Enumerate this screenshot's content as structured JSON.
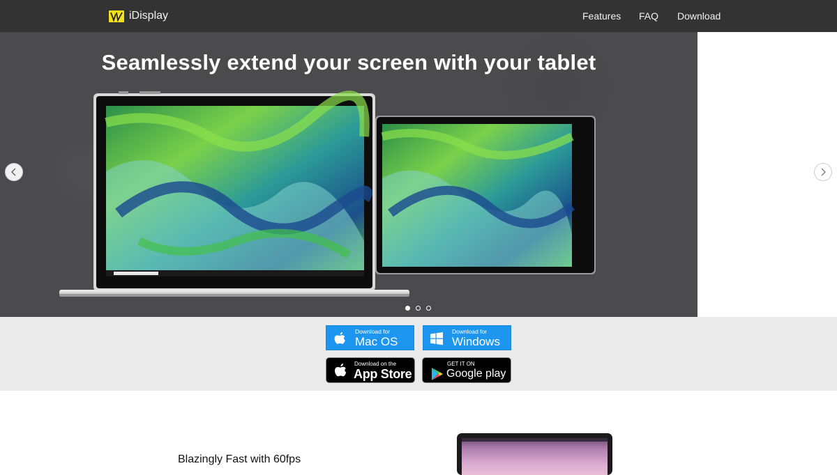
{
  "navbar": {
    "brand": "iDisplay",
    "links": [
      "Features",
      "FAQ",
      "Download"
    ]
  },
  "hero": {
    "title": "Seamlessly extend your screen with your tablet",
    "slide_count": 3,
    "active_slide": 1
  },
  "downloads": {
    "mac": {
      "sub": "Download for",
      "main": "Mac OS"
    },
    "windows": {
      "sub": "Download for",
      "main": "Windows"
    },
    "appstore": {
      "sub": "Download on the",
      "main": "App Store"
    },
    "googleplay": {
      "sub": "GET IT ON",
      "main": "Google play"
    }
  },
  "feature": {
    "heading": "Blazingly Fast with 60fps"
  },
  "colors": {
    "navbar_bg": "#333333",
    "hero_bg": "#4b4a4d",
    "download_strip_bg": "#ebebeb",
    "download_button": "#1d96f0",
    "logo_yellow": "#f5e11b"
  },
  "icons": {
    "logo": "idisplay-logo-icon",
    "prev": "chevron-left-icon",
    "next": "chevron-right-icon",
    "mac": "apple-icon",
    "windows": "windows-icon",
    "appstore": "apple-icon",
    "googleplay": "google-play-icon"
  }
}
